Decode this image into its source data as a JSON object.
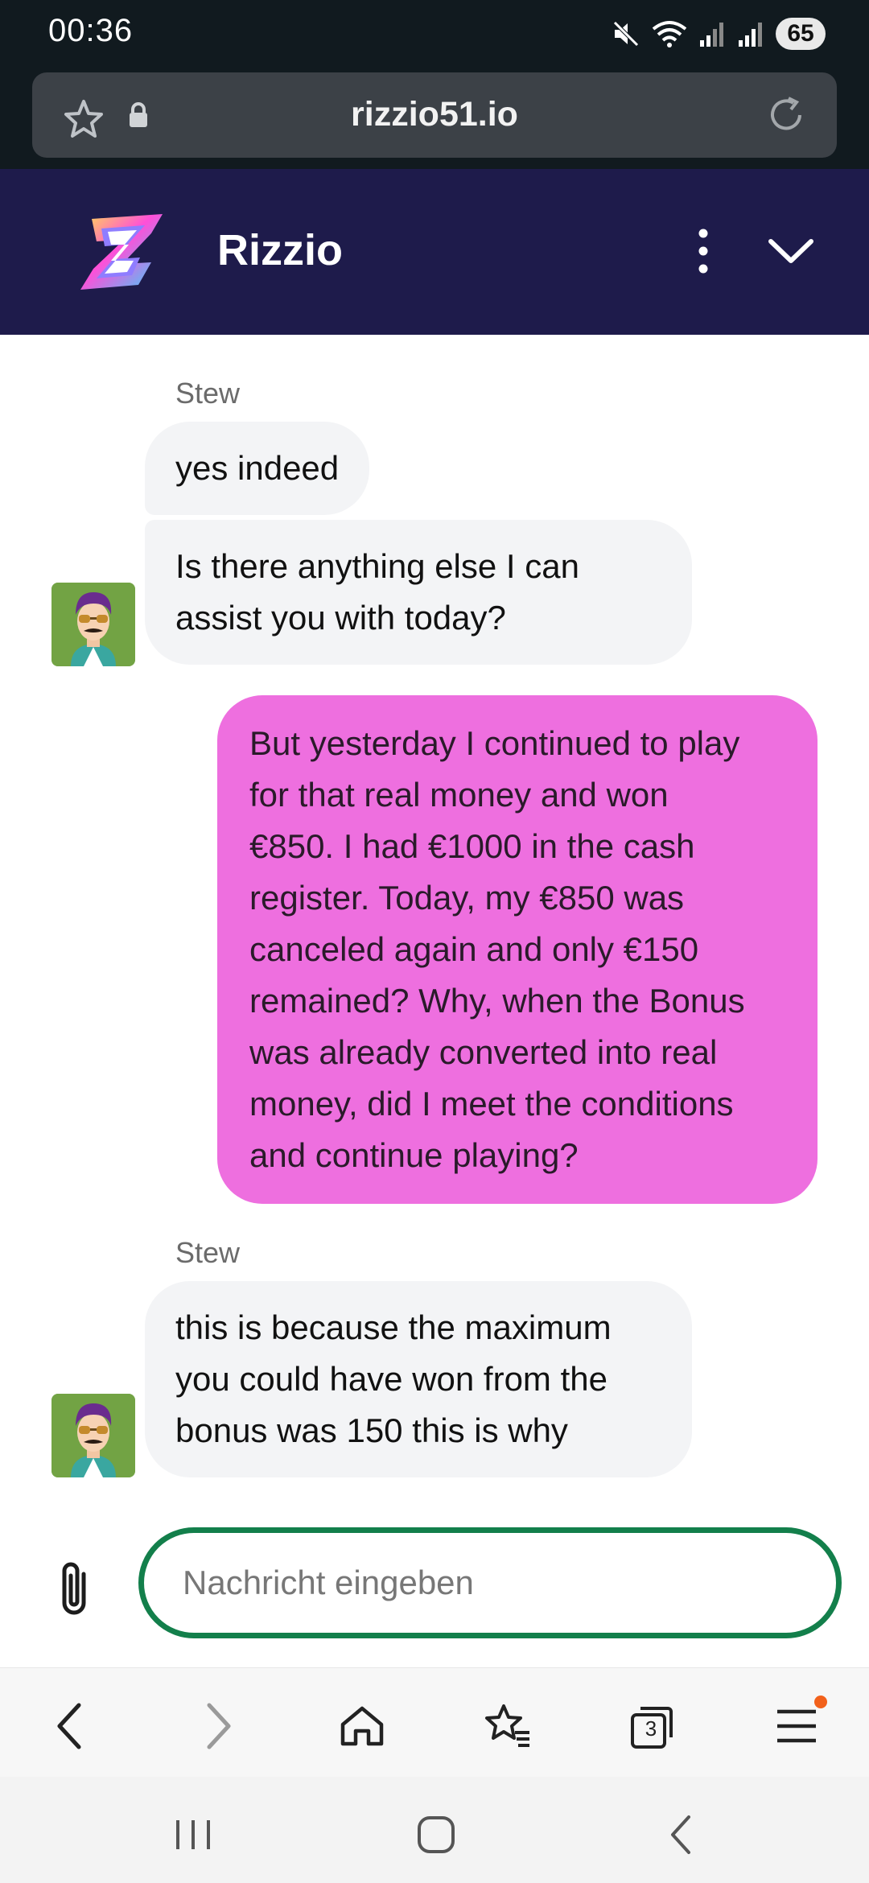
{
  "status_bar": {
    "time": "00:36",
    "battery": "65"
  },
  "browser": {
    "url": "rizzio51.io",
    "tab_count": "3"
  },
  "chat": {
    "brand_name": "Rizzio",
    "input_placeholder": "Nachricht eingeben",
    "messages": [
      {
        "from": "agent",
        "sender": "Stew",
        "lines": [
          "yes indeed"
        ]
      },
      {
        "from": "agent",
        "lines": [
          "Is there anything else I can",
          "assist you with today?"
        ]
      },
      {
        "from": "user",
        "lines": [
          "But yesterday I continued to play",
          "for that real money and won",
          "€850. I had €1000 in the cash",
          "register. Today, my €850 was",
          "canceled again and only €150",
          "remained? Why, when the Bonus",
          "was already converted into real",
          "money, did I meet the conditions",
          "and continue playing?"
        ]
      },
      {
        "from": "agent",
        "sender": "Stew",
        "lines": [
          "this is because the maximum",
          "you could have won from the",
          "bonus was 150 this is why"
        ]
      }
    ]
  },
  "colors": {
    "header_bg": "#1e1b4b",
    "user_bubble": "#ee6fdf",
    "agent_bubble": "#f3f4f6",
    "input_border": "#137f4b",
    "notification_dot": "#f2611b"
  }
}
